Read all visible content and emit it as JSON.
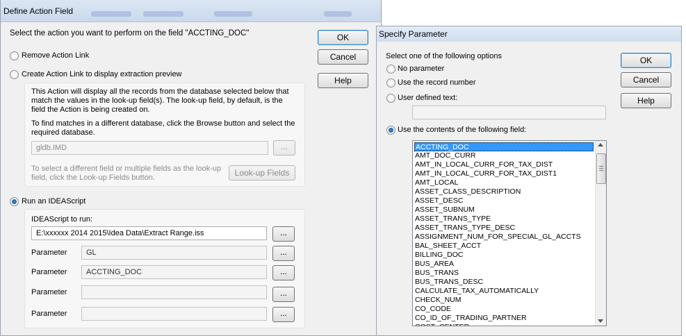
{
  "define_action_window": {
    "title": "Define Action Field",
    "instruction": "Select the action you want to perform on the field \"ACCTING_DOC\"",
    "ok_label": "OK",
    "cancel_label": "Cancel",
    "help_label": "Help",
    "remove_link_label": "Remove Action Link",
    "create_link_label": "Create Action Link to display extraction preview",
    "create_desc_1": "This Action will display all the records from the database selected below that match the values in the look-up field(s).  The look-up field, by default, is the field the Action is being created on.",
    "create_desc_2": "To find matches in a different database, click the Browse button and select the required database.",
    "database_value": "gldb.IMD",
    "lookup_desc": "To select a different field or multiple fields as the look-up field, click the Look-up Fields button.",
    "lookup_button_label": "Look-up Fields",
    "run_script_label": "Run an IDEAScript",
    "script_to_run_label": "IDEAScript to run:",
    "script_path": "E:\\xxxxxx 2014 2015\\Idea Data\\Extract Range.iss",
    "browse_label": "...",
    "parameter_label": "Parameter",
    "parameters": [
      "GL",
      "ACCTING_DOC",
      "",
      ""
    ]
  },
  "specify_parameter_window": {
    "title": "Specify Parameter",
    "instruction": "Select one of the following options",
    "ok_label": "OK",
    "cancel_label": "Cancel",
    "help_label": "Help",
    "options": [
      "No parameter",
      "Use the record number",
      "User defined text:",
      "Use the contents of the following field:"
    ],
    "selected_option": "Use the contents of the following field:",
    "user_text_value": "",
    "fields": [
      "ACCTING_DOC",
      "AMT_DOC_CURR",
      "AMT_IN_LOCAL_CURR_FOR_TAX_DIST",
      "AMT_IN_LOCAL_CURR_FOR_TAX_DIST1",
      "AMT_LOCAL",
      "ASSET_CLASS_DESCRIPTION",
      "ASSET_DESC",
      "ASSET_SUBNUM",
      "ASSET_TRANS_TYPE",
      "ASSET_TRANS_TYPE_DESC",
      "ASSIGNMENT_NUM_FOR_SPECIAL_GL_ACCTS",
      "BAL_SHEET_ACCT",
      "BILLING_DOC",
      "BUS_AREA",
      "BUS_TRANS",
      "BUS_TRANS_DESC",
      "CALCULATE_TAX_AUTOMATICALLY",
      "CHECK_NUM",
      "CO_CODE",
      "CO_ID_OF_TRADING_PARTNER",
      "COST_CENTER"
    ],
    "selected_field": "ACCTING_DOC"
  }
}
